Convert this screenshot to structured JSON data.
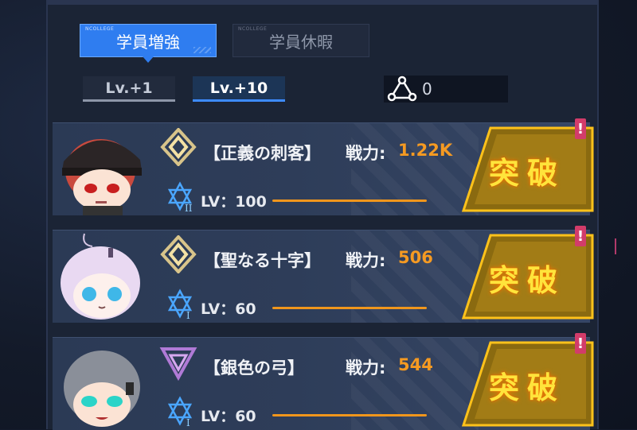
{
  "tabs": [
    {
      "label": "学員増強",
      "tag": "NCOLLEGE",
      "active": true
    },
    {
      "label": "学員休暇",
      "tag": "NCOLLEGE",
      "active": false
    }
  ],
  "level_buttons": [
    {
      "label": "Lv.+1",
      "selected": false
    },
    {
      "label": "Lv.+10",
      "selected": true
    }
  ],
  "counter": {
    "icon": "triangle-nodes-icon",
    "value": "0"
  },
  "cards": [
    {
      "name": "【正義の刺客】",
      "power_label": "戦力:",
      "power": "1.22K",
      "level": "LV：100",
      "rank_icon": "gold-diamond-rank-icon",
      "star_tier": "II",
      "breakthrough_label": "突破",
      "alert": "!"
    },
    {
      "name": "【聖なる十字】",
      "power_label": "戦力:",
      "power": "506",
      "level": "LV：60",
      "rank_icon": "gold-diamond-rank-icon",
      "star_tier": "I",
      "breakthrough_label": "突破",
      "alert": "!"
    },
    {
      "name": "【銀色の弓】",
      "power_label": "戦力:",
      "power": "544",
      "level": "LV：60",
      "rank_icon": "purple-triangle-rank-icon",
      "star_tier": "I",
      "breakthrough_label": "突破",
      "alert": "!"
    }
  ],
  "colors": {
    "accent_blue": "#2f7df0",
    "power_orange": "#f59a22",
    "breakthrough_yellow": "#ffe43b",
    "alert_pink": "#d23c6a"
  }
}
